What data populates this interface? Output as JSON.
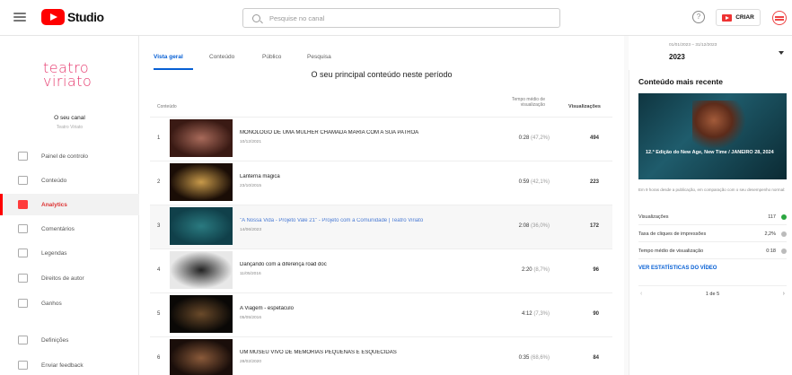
{
  "app": {
    "logo_text": "Studio"
  },
  "search": {
    "placeholder": "Pesquise no canal"
  },
  "header": {
    "help_glyph": "?",
    "create_label": "CRIAR"
  },
  "brand": {
    "line1": "teatro",
    "line2": "viriato"
  },
  "channel": {
    "label": "O seu canal",
    "sub": "Teatro Viriato"
  },
  "sidebar": {
    "items": [
      {
        "label": "Painel de controlo",
        "active": false
      },
      {
        "label": "Conteúdo",
        "active": false
      },
      {
        "label": "Analytics",
        "active": true
      },
      {
        "label": "Comentários",
        "active": false
      },
      {
        "label": "Legendas",
        "active": false
      },
      {
        "label": "Direitos de autor",
        "active": false
      },
      {
        "label": "Ganhos",
        "active": false
      },
      {
        "label": "Definições",
        "active": false
      },
      {
        "label": "Enviar feedback",
        "active": false
      }
    ]
  },
  "tabs": [
    {
      "label": "Vista geral",
      "active": true
    },
    {
      "label": "Conteúdo",
      "active": false
    },
    {
      "label": "Público",
      "active": false
    },
    {
      "label": "Pesquisa",
      "active": false
    }
  ],
  "date": {
    "range": "01/01/2023 – 31/12/2023",
    "year": "2023"
  },
  "main": {
    "section_title": "O seu principal conteúdo neste período",
    "col_content": "Conteúdo",
    "col_avg_line1": "Tempo médio de",
    "col_avg_line2": "visualização",
    "col_views": "Visualizações"
  },
  "rows": [
    {
      "rank": "1",
      "title": "MONÓLOGO DE UMA MULHER CHAMADA MARIA COM A SUA PATROA",
      "date": "10/12/2021",
      "avg": "0:28",
      "pct": "(47,2%)",
      "views": "494",
      "link": false,
      "thumb": [
        "#3a1a14",
        "#a86a5a"
      ]
    },
    {
      "rank": "2",
      "title": "Lanterna mágica",
      "date": "23/10/2015",
      "avg": "0:59",
      "pct": "(42,1%)",
      "views": "223",
      "link": false,
      "thumb": [
        "#1a0d06",
        "#c89a4a"
      ]
    },
    {
      "rank": "3",
      "title": "\"A Nossa Vida - Projeto Vale 21\" - Projeto com a Comunidade | Teatro Viriato",
      "date": "14/06/2023",
      "avg": "2:08",
      "pct": "(36,0%)",
      "views": "172",
      "link": true,
      "thumb": [
        "#10404a",
        "#2a7a80"
      ]
    },
    {
      "rank": "4",
      "title": "Dançando com a diferença road doc",
      "date": "11/05/2016",
      "avg": "2:20",
      "pct": "(8,7%)",
      "views": "96",
      "link": false,
      "thumb": [
        "#e8e8e8",
        "#222222"
      ]
    },
    {
      "rank": "5",
      "title": "A Viagem - espetáculo",
      "date": "05/05/2016",
      "avg": "4:12",
      "pct": "(7,3%)",
      "views": "90",
      "link": false,
      "thumb": [
        "#0a0806",
        "#6a4a2a"
      ]
    },
    {
      "rank": "6",
      "title": "UM MUSEU VIVO DE MEMÓRIAS PEQUENAS E ESQUECIDAS",
      "date": "28/02/2020",
      "avg": "0:35",
      "pct": "(68,6%)",
      "views": "84",
      "link": false,
      "thumb": [
        "#1a0e0a",
        "#8a5a3a"
      ]
    }
  ],
  "right_panel": {
    "title": "Conteúdo mais recente",
    "thumb_text": "12.ª Edição do New Age, New Time / JANEIRO 28, 2024",
    "caption": "Em 9 horas desde a publicação, em comparação com o seu desempenho normal:",
    "stats": [
      {
        "label": "Visualizações",
        "value": "117",
        "indicator": "#2ba640"
      },
      {
        "label": "Taxa de cliques de impressões",
        "value": "2,2%",
        "indicator": "#bbbbbb"
      },
      {
        "label": "Tempo médio de visualização",
        "value": "0:18",
        "indicator": "#bbbbbb"
      }
    ],
    "link": "VER ESTATÍSTICAS DO VÍDEO",
    "pager": "1 de 5",
    "prev_glyph": "‹",
    "next_glyph": "›"
  }
}
